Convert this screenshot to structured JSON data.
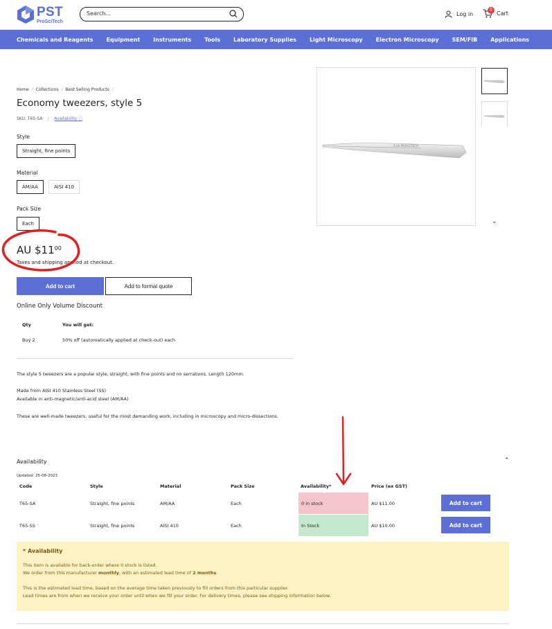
{
  "header": {
    "logo_main": "PST",
    "logo_sub": "ProSciTech",
    "search_placeholder": "Search...",
    "login_label": "Log in",
    "cart_label": "Cart",
    "cart_count": "0"
  },
  "nav": [
    "Chemicals and Reagents",
    "Equipment",
    "Instruments",
    "Tools",
    "Laboratory Supplies",
    "Light Microscopy",
    "Electron Microscopy",
    "SEM/FIB",
    "Applications"
  ],
  "breadcrumb": [
    "Home",
    "Collections",
    "Best Selling Products"
  ],
  "product": {
    "title": "Economy tweezers, style 5",
    "sku": "SKU: T65-SA",
    "availability_link": "Availability ⓘ",
    "style_label": "Style",
    "style_options": [
      "Straight, fine points"
    ],
    "material_label": "Material",
    "material_options": [
      "AM/AA",
      "AISI 410"
    ],
    "pack_label": "Pack Size",
    "pack_options": [
      "Each"
    ],
    "price_main": "AU $11",
    "price_cents": "00",
    "tax_note": "Taxes and shipping applied at checkout.",
    "add_to_cart": "Add to cart",
    "add_to_quote": "Add to formal quote"
  },
  "volume": {
    "title": "Online Only Volume Discount",
    "head_qty": "Qty",
    "head_get": "You will get:",
    "row_qty": "Buy 2",
    "row_get": "50% off (automatically applied at check-out) each"
  },
  "description": {
    "p1": "The style 5 tweezers are a popular style, straight, with fine points and no serrations. Length 120mm.",
    "p2a": "Made from AISI 410 Stainless Steel (SS)",
    "p2b": "Available in anti-magnetic/anti-acid steel (AM/AA)",
    "p3": "These are well-made tweezers, useful for the most demanding work, including in microscopy and micro-dissections."
  },
  "gallery": {
    "image_label": "5-SA PROSCITECH"
  },
  "availability": {
    "title": "Availability",
    "updated": "Updated: 25-08-2023",
    "headers": [
      "Code",
      "Style",
      "Material",
      "Pack Size",
      "Availability*",
      "Price (ex GST)"
    ],
    "rows": [
      {
        "code": "T65-SA",
        "style": "Straight, fine points",
        "material": "AM/AA",
        "pack": "Each",
        "stock": "0 in stock",
        "price": "AU $11.00",
        "button": "Add to cart"
      },
      {
        "code": "T65-SS",
        "style": "Straight, fine points",
        "material": "AISI 410",
        "pack": "Each",
        "stock": "In Stock",
        "price": "AU $10.00",
        "button": "Add to cart"
      }
    ],
    "colors": {
      "out_of_stock": "#f4c6cb",
      "in_stock": "#c6e8cf"
    }
  },
  "notice": {
    "title": "* Availability",
    "l1": "This item is available for back-order where 0 stock is listed.",
    "l2_pre": "We order from this manufacturer ",
    "l2_b1": "monthly",
    "l2_mid": ", with an estimated lead time of ",
    "l2_b2": "2 months",
    "l2_post": ".",
    "l3": "This is the estimated lead time, based on the average time taken previously to fill orders from this particular supplier.",
    "l4": "Lead times are from when we receive your order until when we fill your order. For delivery times, please see shipping information below."
  },
  "colors": {
    "brand": "#5b6fd6",
    "annotation": "#e02020",
    "notice_bg": "#fdf2c6"
  }
}
